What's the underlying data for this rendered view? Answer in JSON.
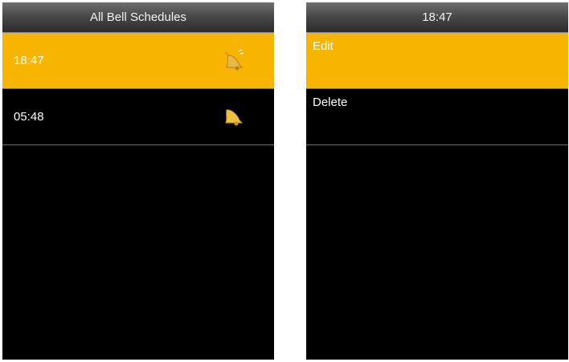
{
  "left_screen": {
    "title": "All Bell Schedules",
    "schedules": [
      {
        "time": "18:47",
        "icon": "bell-icon",
        "selected": true
      },
      {
        "time": "05:48",
        "icon": "bell-icon",
        "selected": false
      }
    ]
  },
  "right_screen": {
    "title": "18:47",
    "menu": [
      {
        "label": "Edit",
        "selected": true
      },
      {
        "label": "Delete",
        "selected": false
      }
    ]
  },
  "colors": {
    "highlight": "#f7b400",
    "background": "#000000",
    "text": "#ffffff"
  }
}
